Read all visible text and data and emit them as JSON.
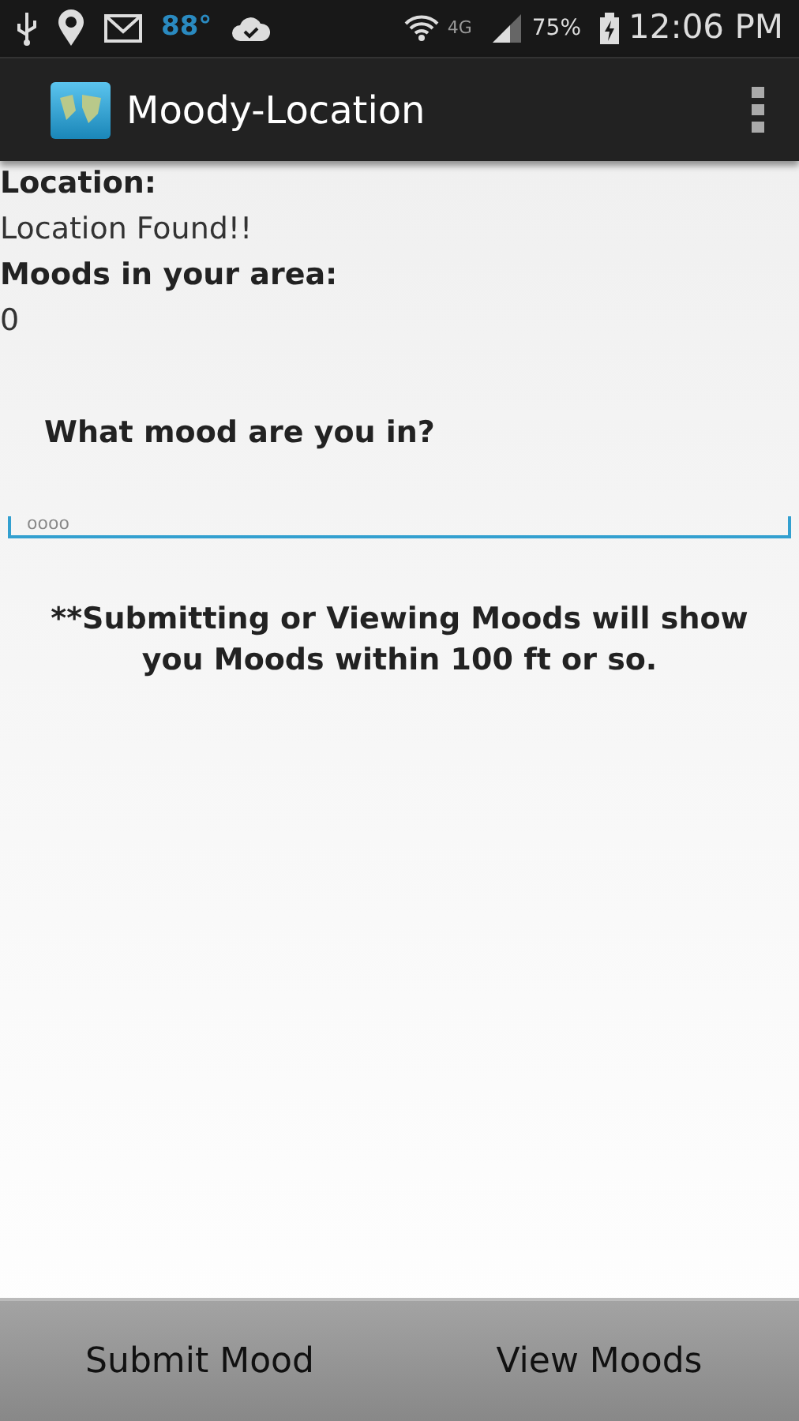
{
  "status_bar": {
    "temperature": "88°",
    "network": "4G",
    "battery": "75%",
    "time": "12:06 PM"
  },
  "action_bar": {
    "title": "Moody-Location"
  },
  "content": {
    "location_label": "Location:",
    "location_value": "Location Found!!",
    "moods_label": "Moods in your area:",
    "moods_count": "0",
    "question": "What mood are you in?",
    "mood_field": {
      "placeholder": "oooo"
    },
    "note": "**Submitting or Viewing Moods will show you Moods within 100 ft or so."
  },
  "buttons": [
    "Submit Mood",
    "View Moods"
  ]
}
